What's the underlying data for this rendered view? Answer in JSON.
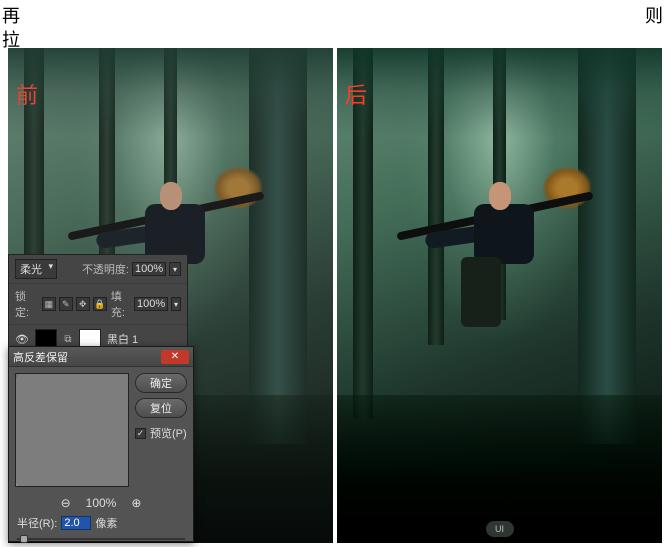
{
  "top": {
    "char_left": "再",
    "char_right": "则",
    "char_left2": "拉"
  },
  "labels": {
    "before": "前",
    "after": "后"
  },
  "watermark": "UI",
  "layers_panel": {
    "blend_mode": "柔光",
    "opacity_label": "不透明度:",
    "opacity_value": "100%",
    "lock_label": "锁定:",
    "fill_label": "填充:",
    "fill_value": "100%",
    "layer_bw": "黑白 1",
    "layer_hp": "高反差保留"
  },
  "dialog": {
    "title": "高反差保留",
    "btn_ok": "确定",
    "btn_reset": "复位",
    "chk_preview": "预览(P)",
    "zoom_pct": "100%",
    "radius_label": "半径(R):",
    "radius_value": "2.0",
    "radius_unit": "像素"
  }
}
